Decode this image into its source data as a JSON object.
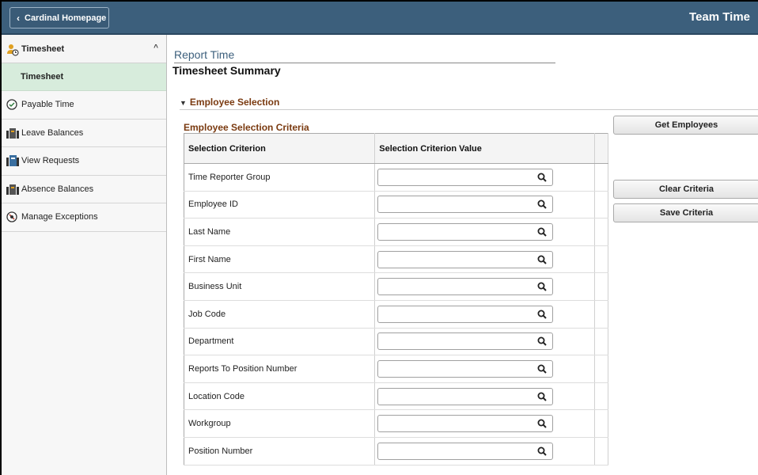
{
  "header": {
    "back_label": "Cardinal Homepage",
    "app_title": "Team Time"
  },
  "sidebar": {
    "group": {
      "label": "Timesheet",
      "icon": "person-clock-icon"
    },
    "sub": {
      "label": "Timesheet"
    },
    "items": [
      {
        "label": "Payable Time",
        "icon": "clock-check-icon"
      },
      {
        "label": "Leave Balances",
        "icon": "balance-icon"
      },
      {
        "label": "View Requests",
        "icon": "requests-icon"
      },
      {
        "label": "Absence Balances",
        "icon": "balance-icon"
      },
      {
        "label": "Manage Exceptions",
        "icon": "exception-icon"
      }
    ]
  },
  "main": {
    "report_time": "Report Time",
    "summary_title": "Timesheet Summary",
    "section_label": "Employee Selection",
    "criteria_title": "Employee Selection Criteria",
    "columns": [
      "Selection Criterion",
      "Selection Criterion Value"
    ],
    "rows": [
      {
        "criterion": "Time Reporter Group",
        "value": ""
      },
      {
        "criterion": "Employee ID",
        "value": ""
      },
      {
        "criterion": "Last Name",
        "value": ""
      },
      {
        "criterion": "First Name",
        "value": ""
      },
      {
        "criterion": "Business Unit",
        "value": ""
      },
      {
        "criterion": "Job Code",
        "value": ""
      },
      {
        "criterion": "Department",
        "value": ""
      },
      {
        "criterion": "Reports To Position Number",
        "value": ""
      },
      {
        "criterion": "Location Code",
        "value": ""
      },
      {
        "criterion": "Workgroup",
        "value": ""
      },
      {
        "criterion": "Position Number",
        "value": ""
      }
    ],
    "buttons": {
      "get_employees": "Get Employees",
      "clear_criteria": "Clear Criteria",
      "save_criteria": "Save Criteria"
    }
  },
  "colors": {
    "header_bg": "#3c5f7c",
    "selected_bg": "#d7ecdc",
    "section_text": "#7a3a10"
  }
}
